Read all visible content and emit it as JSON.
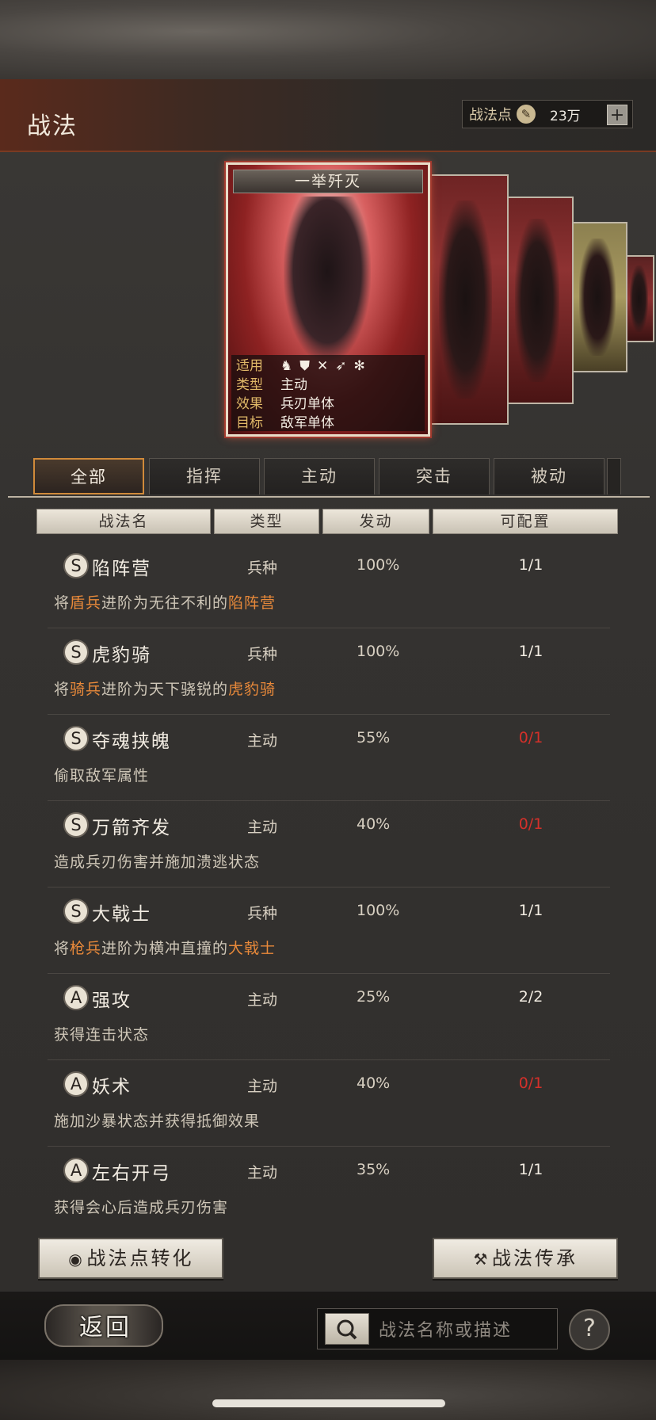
{
  "header": {
    "title": "战法",
    "points_label": "战法点",
    "points_value": "23万",
    "add_label": "+"
  },
  "featured_card": {
    "title": "一举歼灭",
    "info": [
      {
        "key": "适用",
        "value": ""
      },
      {
        "key": "类型",
        "value": "主动"
      },
      {
        "key": "效果",
        "value": "兵刃单体"
      },
      {
        "key": "目标",
        "value": "敌军单体"
      }
    ],
    "unit_icons": [
      "cavalry-icon",
      "shield-icon",
      "bow-icon",
      "spear-icon",
      "wheel-icon"
    ]
  },
  "tabs": [
    {
      "label": "全部",
      "active": true
    },
    {
      "label": "指挥",
      "active": false
    },
    {
      "label": "主动",
      "active": false
    },
    {
      "label": "突击",
      "active": false
    },
    {
      "label": "被动",
      "active": false
    }
  ],
  "columns": [
    "战法名",
    "类型",
    "发动",
    "可配置"
  ],
  "skills": [
    {
      "grade": "S",
      "name": "陷阵营",
      "type": "兵种",
      "rate": "100%",
      "config": "1/1",
      "full": false,
      "desc": [
        "将",
        "盾兵",
        "进阶为无往不利的",
        "陷阵营"
      ]
    },
    {
      "grade": "S",
      "name": "虎豹骑",
      "type": "兵种",
      "rate": "100%",
      "config": "1/1",
      "full": false,
      "desc": [
        "将",
        "骑兵",
        "进阶为天下骁锐的",
        "虎豹骑"
      ]
    },
    {
      "grade": "S",
      "name": "夺魂挟魄",
      "type": "主动",
      "rate": "55%",
      "config": "0/1",
      "full": true,
      "desc": [
        "偷取敌军属性"
      ]
    },
    {
      "grade": "S",
      "name": "万箭齐发",
      "type": "主动",
      "rate": "40%",
      "config": "0/1",
      "full": true,
      "desc": [
        "造成兵刃伤害并施加溃逃状态"
      ]
    },
    {
      "grade": "S",
      "name": "大戟士",
      "type": "兵种",
      "rate": "100%",
      "config": "1/1",
      "full": false,
      "desc": [
        "将",
        "枪兵",
        "进阶为横冲直撞的",
        "大戟士"
      ]
    },
    {
      "grade": "A",
      "name": "强攻",
      "type": "主动",
      "rate": "25%",
      "config": "2/2",
      "full": false,
      "desc": [
        "获得连击状态"
      ]
    },
    {
      "grade": "A",
      "name": "妖术",
      "type": "主动",
      "rate": "40%",
      "config": "0/1",
      "full": true,
      "desc": [
        "施加沙暴状态并获得抵御效果"
      ]
    },
    {
      "grade": "A",
      "name": "左右开弓",
      "type": "主动",
      "rate": "35%",
      "config": "1/1",
      "full": false,
      "desc": [
        "获得会心后造成兵刃伤害"
      ]
    }
  ],
  "buttons": {
    "convert": "战法点转化",
    "inherit": "战法传承"
  },
  "footer": {
    "back": "返回",
    "search_placeholder": "战法名称或描述",
    "help": "?"
  },
  "colors": {
    "accent": "#e8893a",
    "full_red": "#d4302a",
    "tab_active_border": "#d08a3a"
  }
}
